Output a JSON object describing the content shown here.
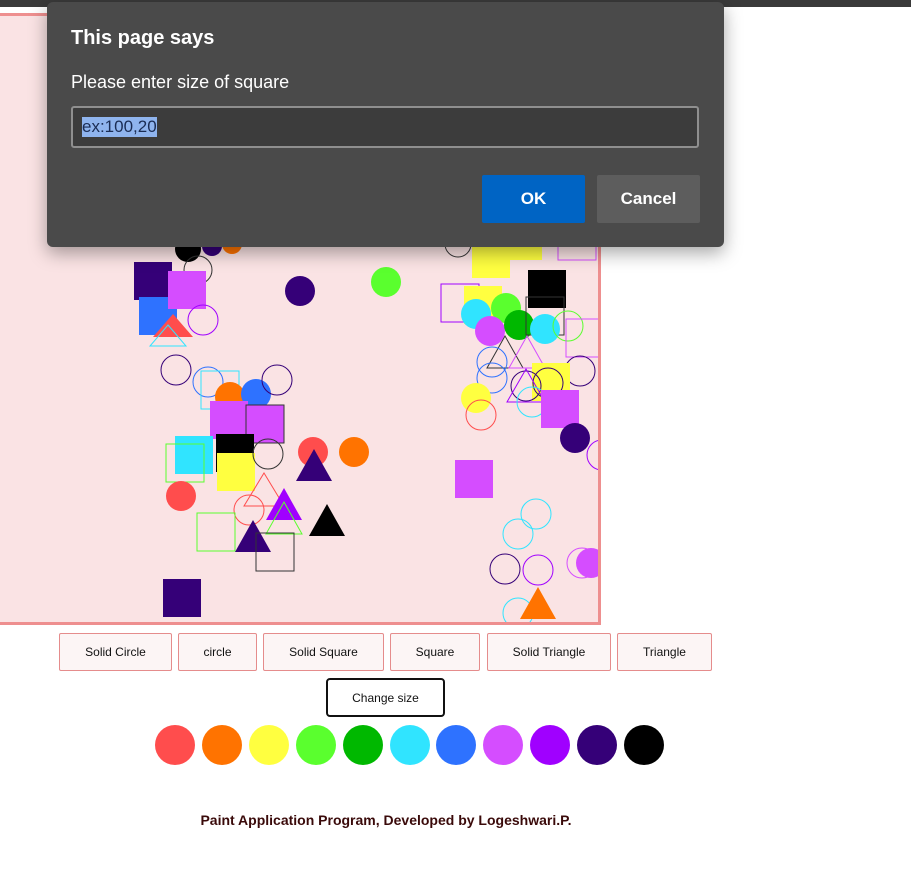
{
  "dialog": {
    "title": "This page says",
    "message": "Please enter size of square",
    "input_value": "ex:100,20",
    "ok_label": "OK",
    "cancel_label": "Cancel"
  },
  "shape_buttons": {
    "solid_circle": "Solid Circle",
    "circle": "circle",
    "solid_square": "Solid Square",
    "square": "Square",
    "solid_triangle": "Solid Triangle",
    "triangle": "Triangle"
  },
  "change_size_label": "Change size",
  "palette": [
    "#ff4d4d",
    "#ff7300",
    "#ffff40",
    "#5aff2e",
    "#00b800",
    "#30e4ff",
    "#2e72ff",
    "#d54dff",
    "#a000ff",
    "#350078",
    "#000000"
  ],
  "canvas_colors": {
    "background": "#fae3e4",
    "border": "#ee8f8f"
  },
  "footer": "Paint Application Program, Developed by Logeshwari.P."
}
